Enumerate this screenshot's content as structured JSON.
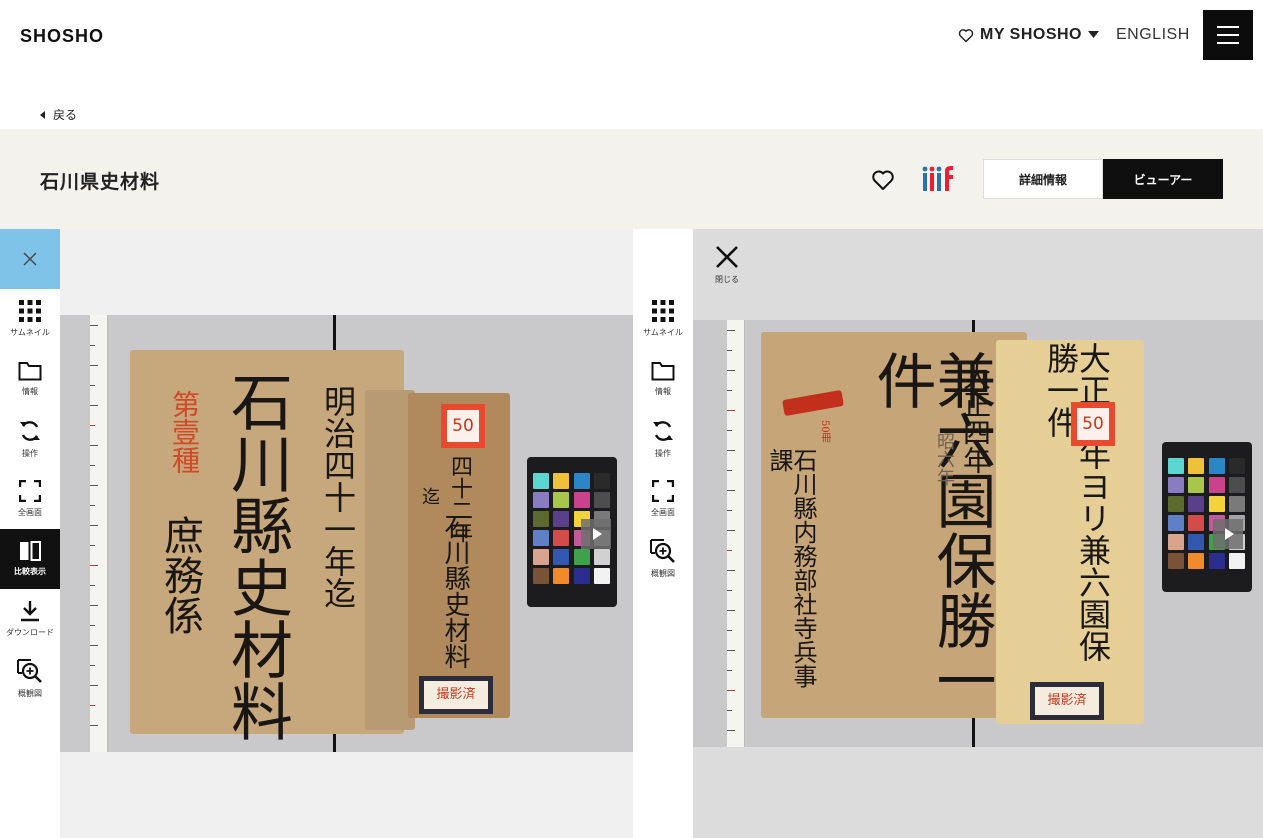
{
  "header": {
    "logo": "SHOSHO",
    "my_shosho": "MY SHOSHO",
    "language": "ENGLISH"
  },
  "back": {
    "label": "戻る"
  },
  "doc": {
    "title": "石川県史材料",
    "tabs": {
      "detail": "詳細情報",
      "viewer": "ビューアー"
    }
  },
  "tools": {
    "thumbnail": "サムネイル",
    "info": "情報",
    "operate": "操作",
    "fullscreen": "全画面",
    "compare": "比較表示",
    "download": "ダウンロード",
    "overview": "概観図"
  },
  "right_pane": {
    "close_label": "閉じる"
  },
  "left_image": {
    "cover_text_main": "石川縣史材料",
    "cover_text_side": "明治四十一年迄",
    "cover_text_red": "第壹種",
    "cover_text_dept": "庶務係",
    "strip_text_1": "四十二年",
    "strip_text_2": "迄",
    "strip_text_3": "石川縣史材料",
    "tag_number": "50",
    "stamp": "撮影済"
  },
  "right_image": {
    "cover_text_main": "兼六園保勝一件",
    "cover_text_side": "大正四年",
    "cover_text_pencil": "昭六年",
    "cover_text_dept": "石川縣内務部社寺兵事課",
    "strip_text": "大正四年ヨリ兼六園保勝一件",
    "tag_number": "50",
    "stamp": "撮影済",
    "red_note": "50冊"
  },
  "colors": {
    "accent_blue": "#7fc4e8",
    "title_bar_bg": "#f3f2ec",
    "active_tool_bg": "#111111",
    "stamp_red": "#e74a2e"
  }
}
